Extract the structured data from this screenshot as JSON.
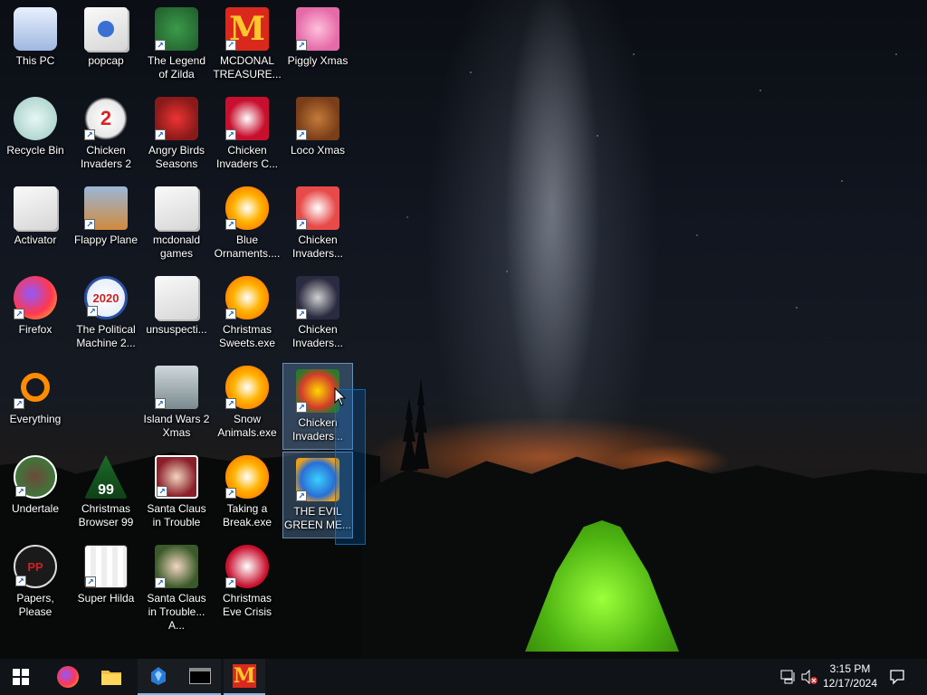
{
  "desktop": {
    "icons": [
      {
        "label": "This PC"
      },
      {
        "label": "popcap"
      },
      {
        "label": "The Legend of Zilda"
      },
      {
        "label": "MCDONAL TREASURE..."
      },
      {
        "label": "Piggly Xmas"
      },
      {
        "label": "Recycle Bin"
      },
      {
        "label": "Chicken Invaders 2"
      },
      {
        "label": "Angry Birds Seasons"
      },
      {
        "label": "Chicken Invaders C..."
      },
      {
        "label": "Loco Xmas"
      },
      {
        "label": "Activator"
      },
      {
        "label": "Flappy Plane"
      },
      {
        "label": "mcdonald games"
      },
      {
        "label": "Blue Ornaments...."
      },
      {
        "label": "Chicken Invaders..."
      },
      {
        "label": "Firefox"
      },
      {
        "label": "The Political Machine 2..."
      },
      {
        "label": "unsuspecti..."
      },
      {
        "label": "Christmas Sweets.exe"
      },
      {
        "label": "Chicken Invaders..."
      },
      {
        "label": "Everything"
      },
      {
        "label": "Island Wars 2 Xmas"
      },
      {
        "label": "Snow Animals.exe"
      },
      {
        "label": "Chicken Invaders..."
      },
      {
        "label": "Undertale"
      },
      {
        "label": "Christmas Browser 99"
      },
      {
        "label": "Santa Claus in Trouble"
      },
      {
        "label": "Taking a Break.exe"
      },
      {
        "label": "THE EVIL GREEN ME..."
      },
      {
        "label": "Papers, Please"
      },
      {
        "label": "Super Hilda"
      },
      {
        "label": "Santa Claus in Trouble... A..."
      },
      {
        "label": "Christmas Eve Crisis"
      }
    ]
  },
  "icon_badges": {
    "political": "2020",
    "chicken2": "2",
    "browser99": "99",
    "mcd": "M",
    "papers": "PP"
  },
  "taskbar": {
    "buttons": [
      "start-windows-icon",
      "firefox-icon",
      "file-explorer-icon",
      "app-icon",
      "terminal-icon",
      "mcdonalds-icon"
    ],
    "mcd_letter": "M"
  },
  "tray": {
    "time": "3:15 PM",
    "date": "12/17/2024"
  },
  "colors": {
    "taskbar": "#101318",
    "accent": "#76b9ed",
    "mcd_red": "#da291c",
    "mcd_yellow": "#ffc72c"
  }
}
